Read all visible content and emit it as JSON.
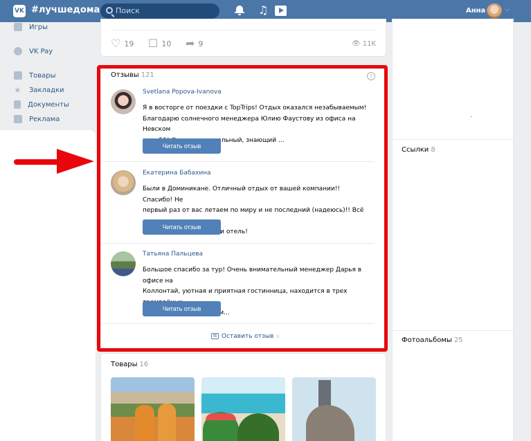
{
  "header": {
    "brand": "#лучшедома",
    "search_placeholder": "Поиск",
    "user_name": "Анна"
  },
  "left_nav": {
    "items": [
      {
        "label": "Игры",
        "icon": "gamepad-icon"
      },
      {
        "label": "VK Pay",
        "icon": "vkpay-icon"
      },
      {
        "label": "Товары",
        "icon": "bag-icon"
      },
      {
        "label": "Закладки",
        "icon": "star-icon"
      },
      {
        "label": "Документы",
        "icon": "document-icon"
      },
      {
        "label": "Реклама",
        "icon": "megaphone-icon"
      }
    ]
  },
  "post": {
    "likes": "19",
    "comments": "10",
    "shares": "9",
    "views": "11K"
  },
  "reviews": {
    "title": "Отзывы",
    "count": "121",
    "help": "?",
    "button_label": "Читать отзыв",
    "leave_label": "Оставить отзыв",
    "items": [
      {
        "name": "Svetlana Popova-Ivanova",
        "text_lines": [
          "Я в восторге от поездки с TopTrips! Отдых оказался незабываемым!",
          "Благодарю солнечного менеджера Юлию Фаустову из офиса на Невском",
          "пр д 51! Очень внимательный, знающий ..."
        ]
      },
      {
        "name": "Екатерина Бабахина",
        "text_lines": [
          "Были в Доминикане. Отличный отдых от вашей компании!! Спасибо! Не",
          "первый раз от вас летаем по миру и не последний (надеюсь)!! Всё очень",
          "понравилось. И страна и отель!"
        ]
      },
      {
        "name": "Татьяна Пальцева",
        "text_lines": [
          "Большое спасибо за тур! Очень внимательный менеджер Дарья в офисе на",
          "Коллонтай, уютная и приятная гостинница, находится в трех трамвайных",
          "остановках от центра, м..."
        ]
      }
    ]
  },
  "goods": {
    "title": "Товары",
    "count": "16"
  },
  "right": {
    "links_title": "Ссылки",
    "links_count": "8",
    "albums_title": "Фотоальбомы",
    "albums_count": "25"
  },
  "colors": {
    "header": "#4a76a8",
    "button": "#5181b8",
    "link": "#2a5885",
    "highlight": "#e8070c"
  }
}
